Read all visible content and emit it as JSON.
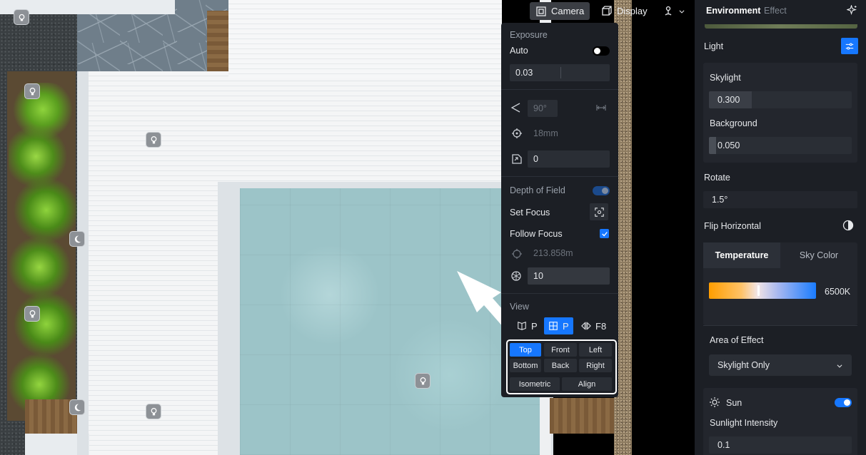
{
  "toolbar": {
    "camera_label": "Camera",
    "display_label": "Display",
    "sun_tool_icon": "sun-direction-icon"
  },
  "camera_panel": {
    "exposure_label": "Exposure",
    "auto_label": "Auto",
    "auto_on": false,
    "exposure_value": "0.03",
    "fov_value": "90°",
    "focal_length_value": "18mm",
    "rotation_value": "0",
    "dof_label": "Depth of Field",
    "dof_on": true,
    "set_focus_label": "Set Focus",
    "follow_focus_label": "Follow Focus",
    "follow_focus_checked": true,
    "focus_distance_value": "213.858m",
    "aperture_value": "10",
    "view_label": "View",
    "view_modes": [
      {
        "label": "P",
        "icon": "perspective-icon",
        "active": false
      },
      {
        "label": "P",
        "icon": "grid-plan-icon",
        "active": true
      },
      {
        "label": "F8",
        "icon": "fisheye-icon",
        "active": false
      }
    ],
    "view_buttons": {
      "top": "Top",
      "front": "Front",
      "left": "Left",
      "bottom": "Bottom",
      "back": "Back",
      "right": "Right",
      "isometric": "Isometric",
      "align": "Align"
    },
    "active_view": "Top"
  },
  "sidebar": {
    "tab_environment": "Environment",
    "tab_effect": "Effect",
    "light_label": "Light",
    "skylight_label": "Skylight",
    "skylight_value": "0.300",
    "skylight_level": 0.3,
    "background_label": "Background",
    "background_value": "0.050",
    "background_level": 0.05,
    "rotate_label": "Rotate",
    "rotate_value": "1.5°",
    "flip_label": "Flip Horizontal",
    "temp_tab": "Temperature",
    "sky_color_tab": "Sky Color",
    "temp_value": "6500K",
    "temp_level": 0.45,
    "area_label": "Area of Effect",
    "area_value": "Skylight Only",
    "sun_label": "Sun",
    "sun_on": true,
    "sunlight_label": "Sunlight Intensity",
    "sunlight_value": "0.1"
  },
  "colors": {
    "accent": "#1677ff",
    "panel_bg": "#1c1f25",
    "input_bg": "#2a2e35"
  }
}
